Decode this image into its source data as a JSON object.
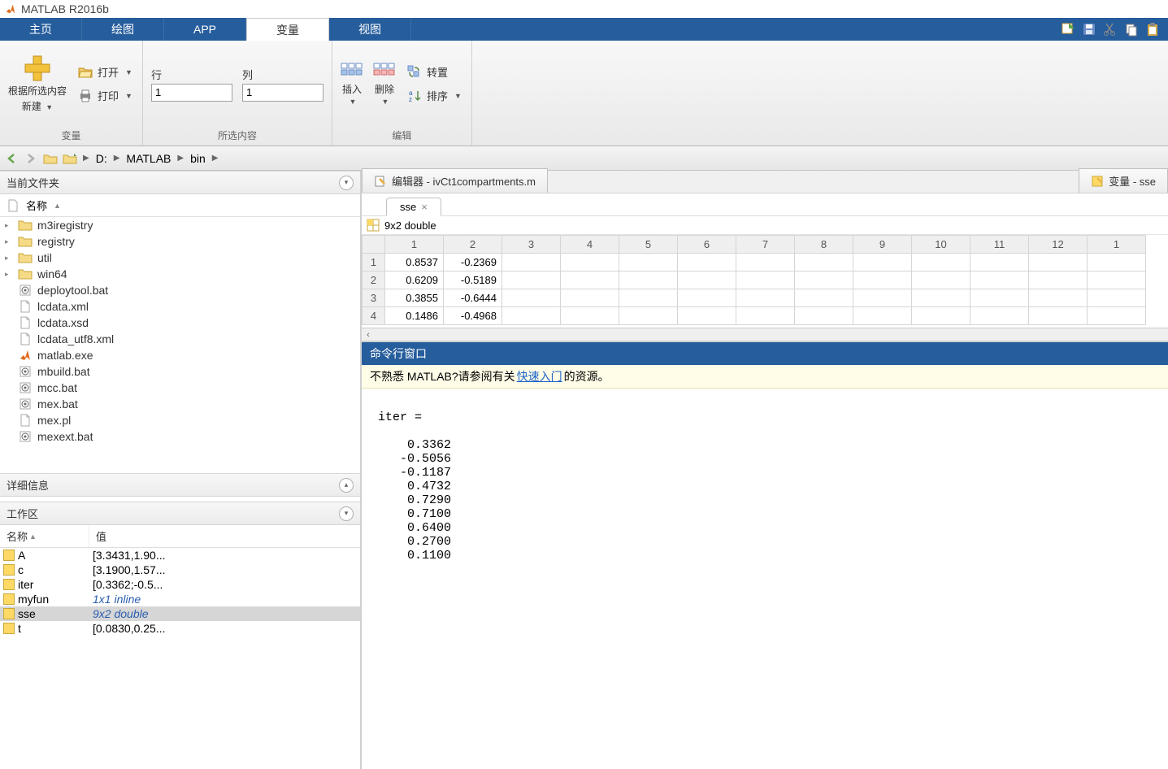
{
  "app": {
    "title": "MATLAB R2016b"
  },
  "tabs": {
    "home": "主页",
    "plots": "绘图",
    "apps": "APP",
    "variable": "变量",
    "view": "视图"
  },
  "ribbon": {
    "group_variable": "变量",
    "group_selection": "所选内容",
    "group_edit": "编辑",
    "new_top": "根据所选内容",
    "new_bottom": "新建",
    "open": "打开",
    "print": "打印",
    "row_label": "行",
    "col_label": "列",
    "row_value": "1",
    "col_value": "1",
    "insert": "插入",
    "delete": "删除",
    "transpose": "转置",
    "sort": "排序"
  },
  "address": {
    "drive": "D:",
    "seg1": "MATLAB",
    "seg2": "bin"
  },
  "left": {
    "current_folder_title": "当前文件夹",
    "name_col": "名称",
    "files": [
      {
        "name": "m3iregistry",
        "type": "folder"
      },
      {
        "name": "registry",
        "type": "folder"
      },
      {
        "name": "util",
        "type": "folder"
      },
      {
        "name": "win64",
        "type": "folder"
      },
      {
        "name": "deploytool.bat",
        "type": "bat"
      },
      {
        "name": "lcdata.xml",
        "type": "xml"
      },
      {
        "name": "lcdata.xsd",
        "type": "xml"
      },
      {
        "name": "lcdata_utf8.xml",
        "type": "xml"
      },
      {
        "name": "matlab.exe",
        "type": "exe"
      },
      {
        "name": "mbuild.bat",
        "type": "bat"
      },
      {
        "name": "mcc.bat",
        "type": "bat"
      },
      {
        "name": "mex.bat",
        "type": "bat"
      },
      {
        "name": "mex.pl",
        "type": "xml"
      },
      {
        "name": "mexext.bat",
        "type": "bat"
      }
    ],
    "details_title": "详细信息",
    "workspace_title": "工作区",
    "ws_name": "名称",
    "ws_value": "值",
    "ws_rows": [
      {
        "name": "A",
        "value": "[3.3431,1.90...",
        "selected": false,
        "inline": false
      },
      {
        "name": "c",
        "value": "[3.1900,1.57...",
        "selected": false,
        "inline": false
      },
      {
        "name": "iter",
        "value": "[0.3362;-0.5...",
        "selected": false,
        "inline": false
      },
      {
        "name": "myfun",
        "value": "1x1 inline",
        "selected": false,
        "inline": true
      },
      {
        "name": "sse",
        "value": "9x2 double",
        "selected": true,
        "inline": true
      },
      {
        "name": "t",
        "value": "[0.0830,0.25...",
        "selected": false,
        "inline": false
      }
    ]
  },
  "editor": {
    "editor_tab": "编辑器 - ivCt1compartments.m",
    "variable_tab": "变量 - sse",
    "var_tab_name": "sse",
    "var_type": "9x2 double",
    "col_headers": [
      "1",
      "2",
      "3",
      "4",
      "5",
      "6",
      "7",
      "8",
      "9",
      "10",
      "11",
      "12",
      "1"
    ],
    "rows": [
      {
        "h": "1",
        "c": [
          "0.8537",
          "-0.2369"
        ]
      },
      {
        "h": "2",
        "c": [
          "0.6209",
          "-0.5189"
        ]
      },
      {
        "h": "3",
        "c": [
          "0.3855",
          "-0.6444"
        ]
      },
      {
        "h": "4",
        "c": [
          "0.1486",
          "-0.4968"
        ]
      }
    ]
  },
  "cmd": {
    "title": "命令行窗口",
    "hint_pre": "不熟悉 MATLAB?请参阅有关",
    "hint_link": "快速入门",
    "hint_post": "的资源。",
    "body": "\niter =\n\n    0.3362\n   -0.5056\n   -0.1187\n    0.4732\n    0.7290\n    0.7100\n    0.6400\n    0.2700\n    0.1100\n"
  }
}
